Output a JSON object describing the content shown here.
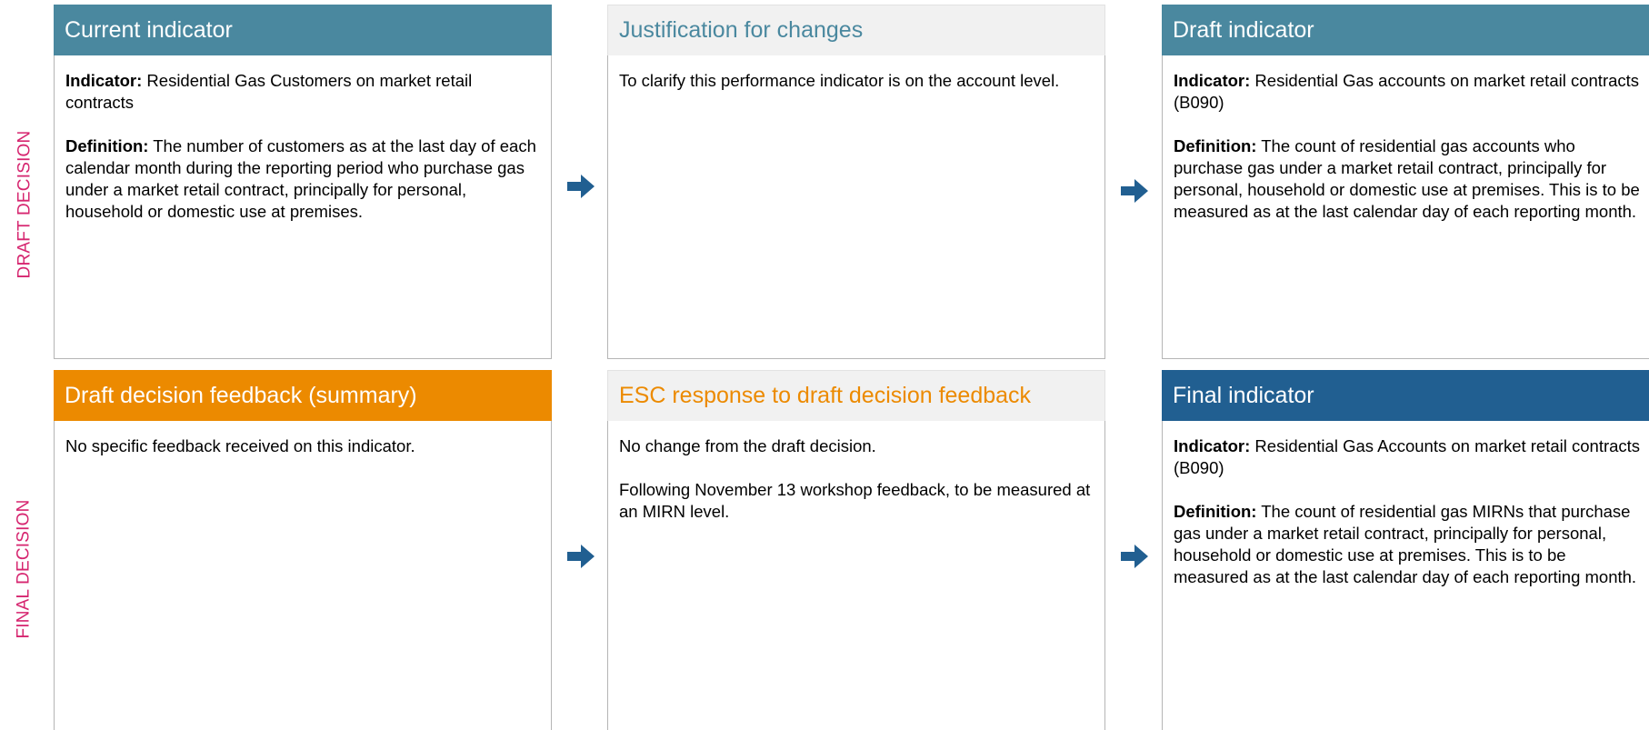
{
  "rows": {
    "draft_label": "DRAFT DECISION",
    "final_label": "FINAL DECISION"
  },
  "current": {
    "header": "Current indicator",
    "indicator_label": "Indicator:",
    "indicator_text": " Residential Gas Customers on market retail contracts",
    "definition_label": "Definition:",
    "definition_text": " The number of customers as at the last day of each calendar month during the reporting period who purchase gas under a market retail contract, principally for personal, household or domestic use at premises."
  },
  "justification": {
    "header": "Justification for changes",
    "text": "To clarify this performance indicator is on the account level."
  },
  "draft": {
    "header": "Draft indicator",
    "indicator_label": "Indicator:",
    "indicator_text": " Residential Gas accounts on market retail contracts (B090)",
    "definition_label": "Definition:",
    "definition_text": " The count of residential gas accounts who purchase gas under a market retail contract, principally for personal, household or domestic use at premises. This is to be measured as at the last calendar day of each reporting month."
  },
  "feedback": {
    "header": "Draft decision feedback (summary)",
    "text": "No specific feedback received on this indicator."
  },
  "response": {
    "header": "ESC response to draft decision feedback",
    "text1": "No change from the draft decision.",
    "text2": "Following November 13 workshop feedback, to be measured at an MIRN level."
  },
  "final": {
    "header": "Final indicator",
    "indicator_label": "Indicator:",
    "indicator_text": " Residential Gas Accounts on market retail contracts (B090)",
    "definition_label": "Definition:",
    "definition_text": " The count of residential gas MIRNs that purchase gas under a market retail contract, principally for personal, household or domestic use at premises. This is to be measured as at the last calendar day of each reporting month."
  },
  "icons": {
    "arrow": "arrow-right-icon",
    "arrow_color": "#215f91"
  },
  "colors": {
    "teal": "#4a889f",
    "orange": "#ec8a00",
    "blue": "#215f91",
    "magenta": "#d6256f"
  }
}
